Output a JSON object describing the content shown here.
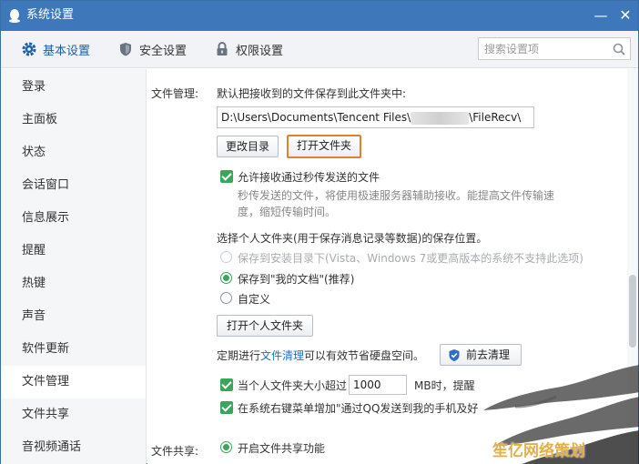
{
  "window": {
    "title": "系统设置"
  },
  "toolbar": {
    "tabs": [
      {
        "label": "基本设置",
        "icon": "gear-icon"
      },
      {
        "label": "安全设置",
        "icon": "shield-icon"
      },
      {
        "label": "权限设置",
        "icon": "lock-icon"
      }
    ],
    "search_placeholder": "搜索设置项"
  },
  "sidebar": {
    "items": [
      {
        "label": "登录"
      },
      {
        "label": "主面板"
      },
      {
        "label": "状态"
      },
      {
        "label": "会话窗口"
      },
      {
        "label": "信息展示"
      },
      {
        "label": "提醒"
      },
      {
        "label": "热键"
      },
      {
        "label": "声音"
      },
      {
        "label": "软件更新"
      },
      {
        "label": "文件管理"
      },
      {
        "label": "文件共享"
      },
      {
        "label": "音视频通话"
      }
    ],
    "selected": "文件管理"
  },
  "file_mgmt": {
    "section_label": "文件管理:",
    "save_to_label": "默认把接收到的文件保存到此文件夹中:",
    "path_prefix": "D:\\Users\\Documents\\Tencent Files\\",
    "path_suffix": "\\FileRecv\\",
    "change_dir_button": "更改目录",
    "open_folder_button": "打开文件夹",
    "allow_flash_label": "允许接收通过秒传发送的文件",
    "allow_flash_desc_1": "秒传发送的文件，将使用极速服务器辅助接收。能提高文件传输速",
    "allow_flash_desc_2": "度，缩短传输时间。",
    "personal_folder_label": "选择个人文件夹(用于保存消息记录等数据)的保存位置。",
    "radio_install_dir": "保存到安装目录下(Vista、Windows 7或更高版本的系统不支持此选项)",
    "radio_my_docs": "保存到\"我的文档\"(推荐)",
    "radio_custom": "自定义",
    "open_personal_button": "打开个人文件夹",
    "clean_text_prefix": "定期进行",
    "clean_link": "文件清理",
    "clean_text_suffix": "可以有效节省硬盘空间。",
    "clean_button": "前去清理",
    "size_limit_prefix": "当个人文件夹大小超过",
    "size_limit_value": "1000",
    "size_limit_suffix": "MB时，提醒",
    "context_menu_label": "在系统右键菜单增加\"通过QQ发送到我的手机及好"
  },
  "file_share": {
    "section_label": "文件共享:",
    "enable_label": "开启文件共享功能"
  },
  "watermark": "笙亿网络策划"
}
